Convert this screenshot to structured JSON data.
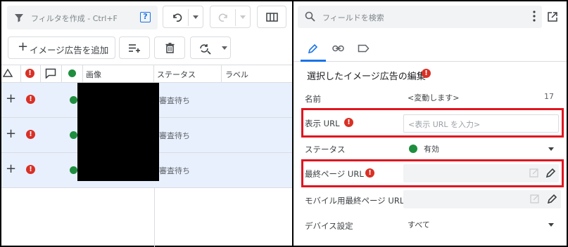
{
  "toolbar": {
    "filter_placeholder": "フィルタを作成 - Ctrl+F",
    "help_label": "?",
    "add_button_label": "イメージ広告を追加"
  },
  "table": {
    "columns": [
      "画像",
      "ステータス",
      "ラベル"
    ],
    "rows": [
      {
        "status": "審査待ち"
      },
      {
        "status": "審査待ち"
      },
      {
        "status": "審査待ち"
      }
    ]
  },
  "panel": {
    "search_placeholder": "フィールドを検索",
    "section_title": "選択したイメージ広告の編集",
    "fields": {
      "name": {
        "label": "名前",
        "value": "<変動します>",
        "count": "17"
      },
      "display_url": {
        "label": "表示 URL",
        "placeholder": "<表示 URL を入力>"
      },
      "status": {
        "label": "ステータス",
        "value": "有効"
      },
      "final_url": {
        "label": "最終ページ URL",
        "value": ""
      },
      "mobile_final_url": {
        "label": "モバイル用最終ページ URL",
        "value": ""
      },
      "device": {
        "label": "デバイス設定",
        "value": "すべて"
      }
    }
  },
  "colors": {
    "accent": "#1a73e8",
    "error": "#d93025",
    "highlight_border": "#e0151f",
    "status_green": "#1e8e3e",
    "selected_row": "#e8f0fe"
  },
  "icons": {
    "error": "!",
    "plus": "+"
  }
}
